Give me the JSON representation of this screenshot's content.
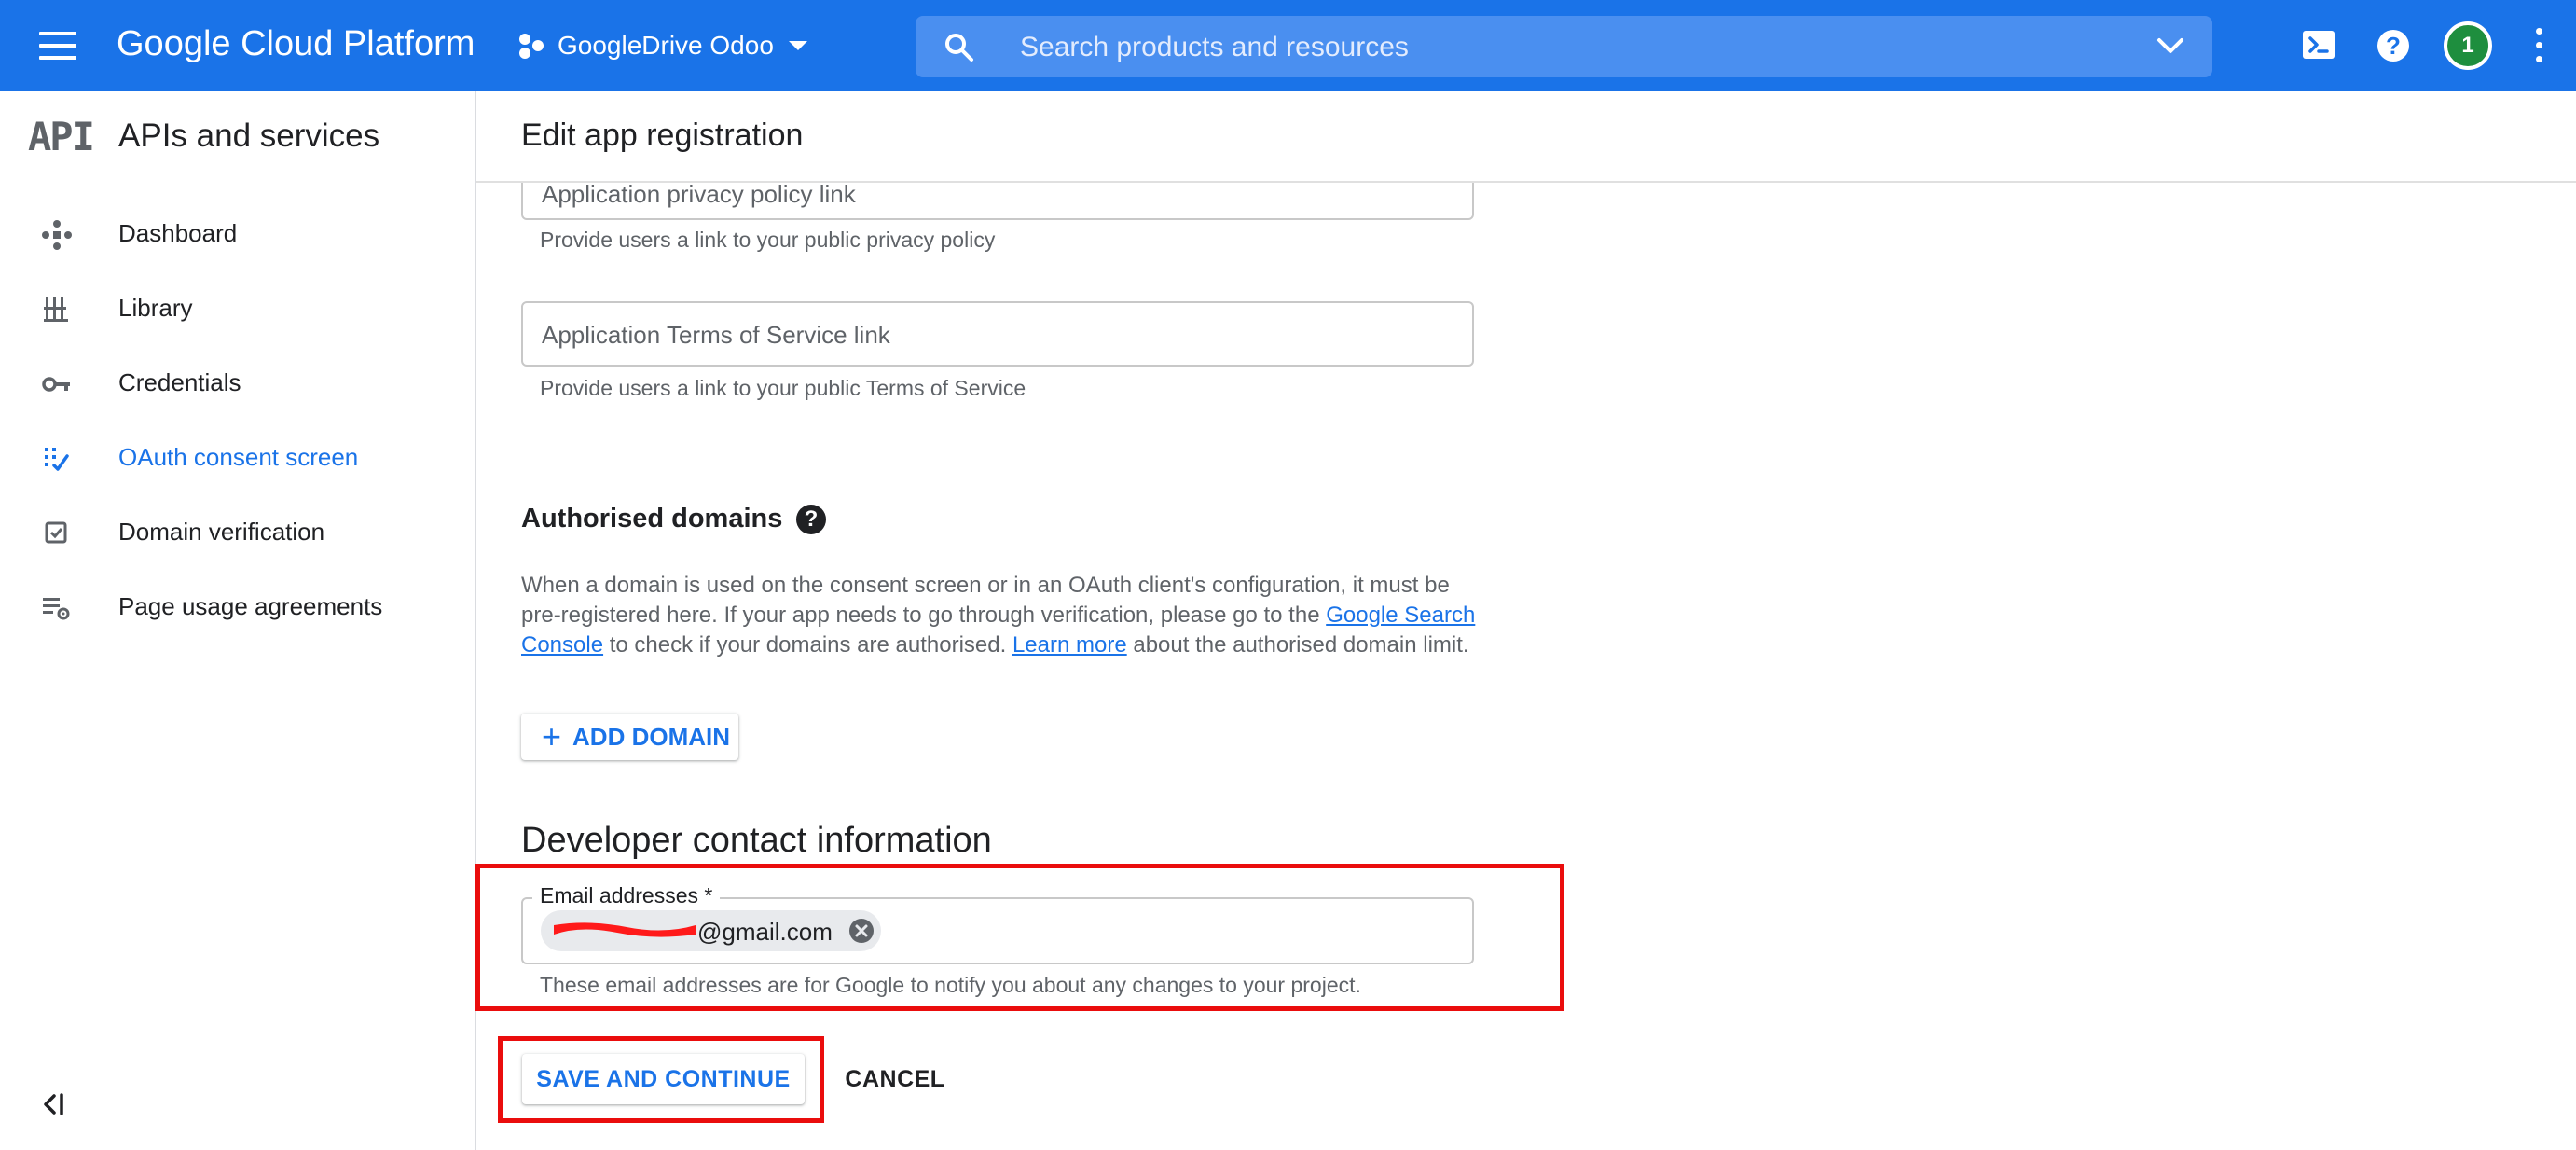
{
  "header": {
    "brand": "Google Cloud Platform",
    "project_name": "GoogleDrive Odoo",
    "search_placeholder": "Search products and resources",
    "account_initial": "1"
  },
  "sidebar": {
    "logo": "API",
    "title": "APIs and services",
    "items": [
      {
        "label": "Dashboard",
        "icon": "dashboard-icon",
        "active": false
      },
      {
        "label": "Library",
        "icon": "library-icon",
        "active": false
      },
      {
        "label": "Credentials",
        "icon": "key-icon",
        "active": false
      },
      {
        "label": "OAuth consent screen",
        "icon": "oauth-consent-icon",
        "active": true
      },
      {
        "label": "Domain verification",
        "icon": "checkbox-icon",
        "active": false
      },
      {
        "label": "Page usage agreements",
        "icon": "settings-list-icon",
        "active": false
      }
    ]
  },
  "main": {
    "page_title": "Edit app registration",
    "privacy_field": {
      "placeholder": "Application privacy policy link",
      "hint": "Provide users a link to your public privacy policy"
    },
    "tos_field": {
      "placeholder": "Application Terms of Service link",
      "hint": "Provide users a link to your public Terms of Service"
    },
    "authorised_domains": {
      "heading": "Authorised domains",
      "p1": "When a domain is used on the consent screen or in an OAuth client's configuration, it must be pre-registered here. If your app needs to go through verification, please go to the ",
      "link1": "Google Search Console",
      "p2": " to check if your domains are authorised. ",
      "link2": "Learn more",
      "p3": " about the authorised domain limit.",
      "add_button": "ADD DOMAIN"
    },
    "developer_contact": {
      "heading": "Developer contact information",
      "email_label": "Email addresses *",
      "email_value": "@gmail.com",
      "hint": "These email addresses are for Google to notify you about any changes to your project."
    },
    "actions": {
      "save": "SAVE AND CONTINUE",
      "cancel": "CANCEL"
    }
  },
  "colors": {
    "brand": "#1a73e8",
    "highlight": "#ea0d0d"
  }
}
